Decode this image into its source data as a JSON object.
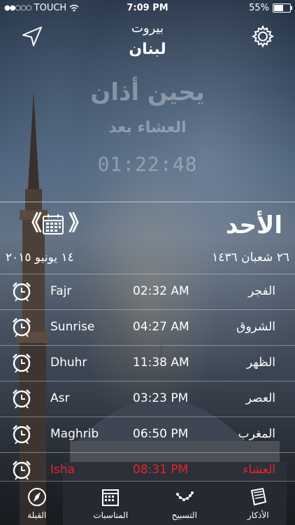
{
  "status": {
    "carrier": "TOUCH",
    "time": "7:09 PM",
    "battery": "55%"
  },
  "header": {
    "city": "بيروت",
    "country": "لبنان"
  },
  "countdown": {
    "line1": "يحين أذان",
    "line2": "العشاء بعد",
    "remaining": "01:22:48"
  },
  "day": {
    "name": "الأحد",
    "hijri_date": "٢٦ شعبان ١٤٣٦",
    "gregorian_date": "١٤ يونيو ٢٠١٥",
    "prev_symbol": "《",
    "next_symbol": "》"
  },
  "prayers": [
    {
      "en": "Fajr",
      "time": "02:32 AM",
      "ar": "الفجر"
    },
    {
      "en": "Sunrise",
      "time": "04:27 AM",
      "ar": "الشروق"
    },
    {
      "en": "Dhuhr",
      "time": "11:38 AM",
      "ar": "الظهر"
    },
    {
      "en": "Asr",
      "time": "03:23 PM",
      "ar": "العصر"
    },
    {
      "en": "Maghrib",
      "time": "06:50 PM",
      "ar": "المغرب"
    },
    {
      "en": "Isha",
      "time": "08:31 PM",
      "ar": "العشاء"
    }
  ],
  "highlight_color": "#e8232a",
  "tabs": [
    {
      "label": "القبلة",
      "icon": "compass-icon"
    },
    {
      "label": "المناسبات",
      "icon": "calendar-icon"
    },
    {
      "label": "التسبيح",
      "icon": "prayer-beads-icon"
    },
    {
      "label": "الأذكار",
      "icon": "book-icon"
    }
  ]
}
